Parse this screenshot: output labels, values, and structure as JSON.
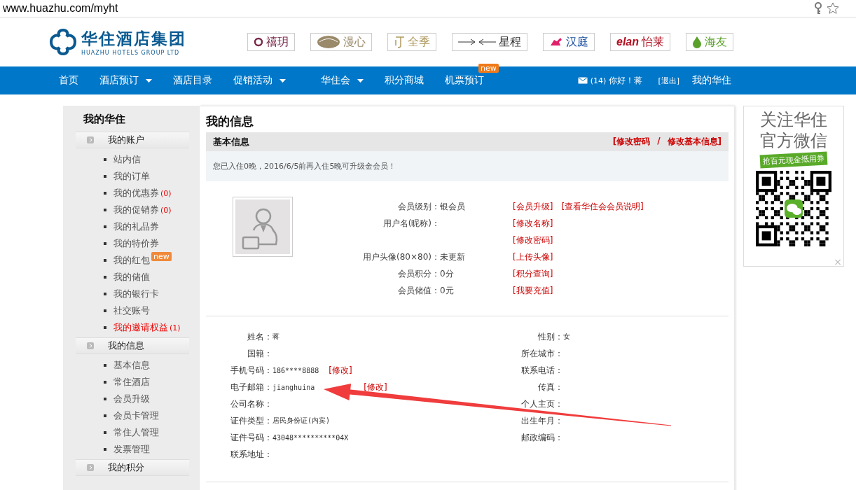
{
  "address_bar": {
    "url": "www.huazhu.com/myht"
  },
  "logo": {
    "name": "华住酒店集团",
    "subtitle": "HUAZHU HOTELS GROUP LTD"
  },
  "brands": [
    {
      "label": "禧玥",
      "kind": "ring",
      "color": "#7a2a4a"
    },
    {
      "label": "漫心",
      "kind": "shell",
      "color": "#9a8a6a"
    },
    {
      "label": "全季",
      "kind": "ji",
      "color": "#b09a60"
    },
    {
      "label": "星程",
      "kind": "arrows",
      "color": "#333333"
    },
    {
      "label": "汉庭",
      "kind": "horse",
      "color": "#1a4fa0"
    },
    {
      "label": "怡莱",
      "kind": "elan",
      "color": "#b01020",
      "mark": "elan"
    },
    {
      "label": "海友",
      "kind": "drop",
      "color": "#5aa02a"
    }
  ],
  "nav": {
    "items": [
      {
        "label": "首页",
        "dropdown": false
      },
      {
        "label": "酒店预订",
        "dropdown": true
      },
      {
        "label": "酒店目录",
        "dropdown": false
      },
      {
        "label": "促销活动",
        "dropdown": true
      },
      {
        "label": "华住会",
        "dropdown": true
      },
      {
        "label": "积分商城",
        "dropdown": false
      },
      {
        "label": "机票预订",
        "dropdown": false,
        "badge": "new"
      }
    ],
    "mail_count": "(14)",
    "greeting": "你好！蒋",
    "logout": "[退出]",
    "my_link": "我的华住"
  },
  "sidebar": {
    "title": "我的华住",
    "groups": [
      {
        "title": "我的账户",
        "items": [
          {
            "label": "站内信",
            "highlighted": false
          },
          {
            "label": "我的订单",
            "highlighted": false
          },
          {
            "label": "我的优惠券",
            "count": "(0)",
            "highlighted": false
          },
          {
            "label": "我的促销券",
            "count": "(0)",
            "highlighted": false
          },
          {
            "label": "我的礼品券",
            "highlighted": false
          },
          {
            "label": "我的特价券",
            "highlighted": false
          },
          {
            "label": "我的红包",
            "badge": "new",
            "highlighted": false
          },
          {
            "label": "我的储值",
            "highlighted": false
          },
          {
            "label": "我的银行卡",
            "highlighted": false
          },
          {
            "label": "社交账号",
            "highlighted": false
          },
          {
            "label": "我的邀请权益",
            "count": "(1)",
            "highlighted": true
          }
        ]
      },
      {
        "title": "我的信息",
        "items": [
          {
            "label": "基本信息",
            "highlighted": false
          },
          {
            "label": "常住酒店",
            "highlighted": false
          },
          {
            "label": "会员升级",
            "highlighted": false
          },
          {
            "label": "会员卡管理",
            "highlighted": false
          },
          {
            "label": "常住人管理",
            "highlighted": false
          },
          {
            "label": "发票管理",
            "highlighted": false
          }
        ]
      },
      {
        "title": "我的积分"
      }
    ]
  },
  "main": {
    "title": "我的信息",
    "section": "基本信息",
    "actions": [
      "[修改密码",
      "修改基本信息]"
    ],
    "action_separator": "/",
    "notice": "您已入住0晚，2016/6/5前再入住5晚可升级金会员！",
    "membership": [
      {
        "label": "会员级别：",
        "value": "银会员",
        "links": [
          "[会员升级]",
          "[查看华住会会员说明]"
        ]
      },
      {
        "label": "用户名(昵称)：",
        "links": [
          "[修改名称]"
        ]
      },
      {
        "links": [
          "[修改密码]"
        ]
      },
      {
        "label": "用户头像(80×80)：",
        "value": "未更新",
        "links": [
          "[上传头像]"
        ]
      },
      {
        "label": "会员积分：",
        "value": "0分",
        "links": [
          "[积分查询]"
        ]
      },
      {
        "label": "会员储值：",
        "value": "0元",
        "links": [
          "[我要充值]"
        ]
      }
    ],
    "personal_left": [
      {
        "label": "姓名：",
        "value": "蒋"
      },
      {
        "label": "国籍："
      },
      {
        "label": "手机号码：",
        "value": "186****8888",
        "link": "[修改]"
      },
      {
        "label": "电子邮箱：",
        "value": "jianghuina",
        "link": "[修改]"
      },
      {
        "label": "公司名称："
      },
      {
        "label": "证件类型：",
        "value": "居民身份证(内宾)"
      },
      {
        "label": "证件号码：",
        "value": "43048**********04X"
      },
      {
        "label": "联系地址："
      }
    ],
    "personal_right": [
      {
        "label": "性别：",
        "value": "女"
      },
      {
        "label": "所在城市："
      },
      {
        "label": "联系电话："
      },
      {
        "label": "传真："
      },
      {
        "label": "个人主页："
      },
      {
        "label": "出生年月："
      },
      {
        "label": "邮政编码："
      }
    ]
  },
  "ad": {
    "lines": [
      "关注华住",
      "官方微信"
    ],
    "ribbon": "抢百元现金抵用券",
    "close": "×"
  }
}
